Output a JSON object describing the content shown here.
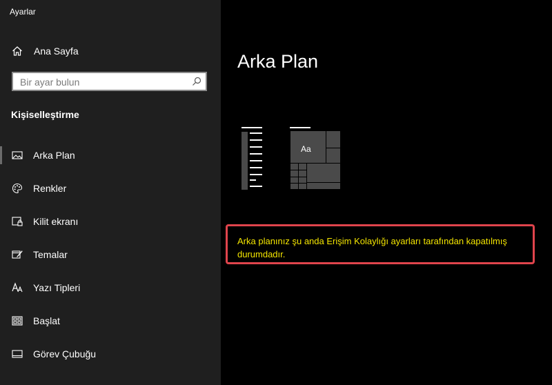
{
  "window": {
    "title": "Ayarlar"
  },
  "sidebar": {
    "home_label": "Ana Sayfa",
    "search": {
      "placeholder": "Bir ayar bulun",
      "value": ""
    },
    "section_title": "Kişiselleştirme",
    "items": [
      {
        "label": "Arka Plan",
        "icon": "picture-icon",
        "selected": true
      },
      {
        "label": "Renkler",
        "icon": "palette-icon",
        "selected": false
      },
      {
        "label": "Kilit ekranı",
        "icon": "lock-screen-icon",
        "selected": false
      },
      {
        "label": "Temalar",
        "icon": "themes-icon",
        "selected": false
      },
      {
        "label": "Yazı Tipleri",
        "icon": "fonts-icon",
        "selected": false
      },
      {
        "label": "Başlat",
        "icon": "start-icon",
        "selected": false
      },
      {
        "label": "Görev Çubuğu",
        "icon": "taskbar-icon",
        "selected": false
      }
    ]
  },
  "main": {
    "title": "Arka Plan",
    "preview_text": "Aa",
    "notice": "Arka planınız şu anda Erişim Kolaylığı ayarları tarafından kapatılmış durumdadır."
  },
  "colors": {
    "sidebar_bg": "#1f1f1f",
    "main_bg": "#000000",
    "notice_text": "#f5e600",
    "notice_border": "#e0444c"
  }
}
